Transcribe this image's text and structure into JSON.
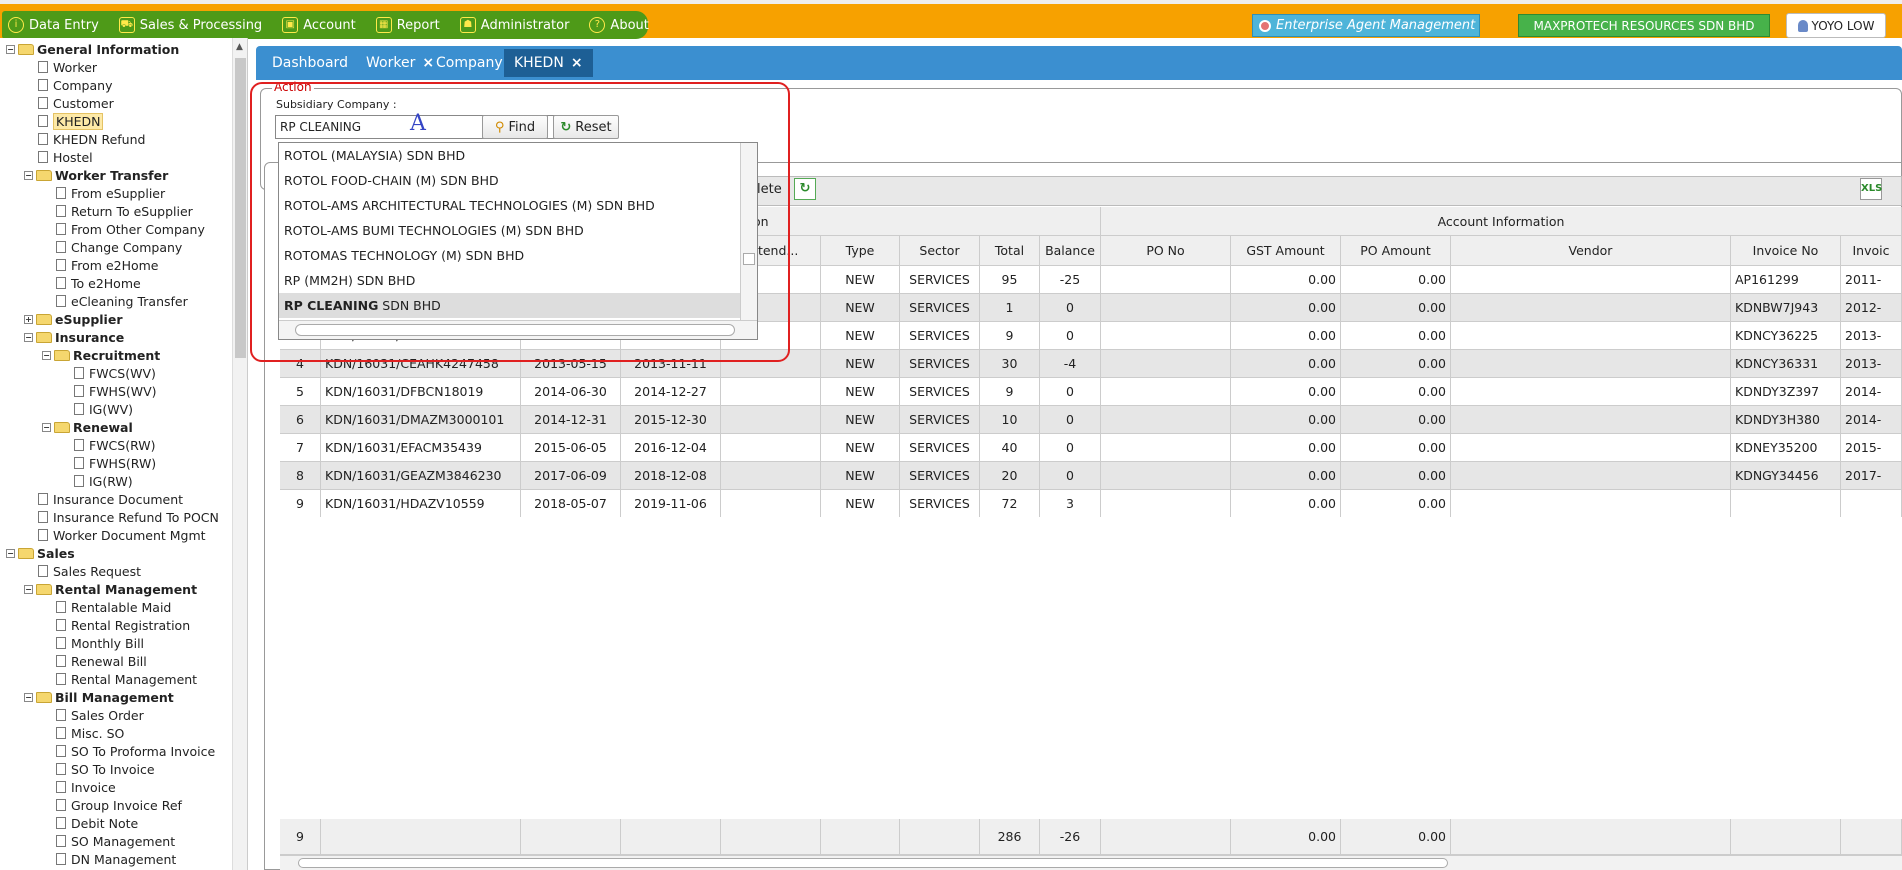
{
  "menu": {
    "items": [
      {
        "label": "Data Entry",
        "icon": "info-icon"
      },
      {
        "label": "Sales & Processing",
        "icon": "cart-icon"
      },
      {
        "label": "Account",
        "icon": "briefcase-icon"
      },
      {
        "label": "Report",
        "icon": "table-icon"
      },
      {
        "label": "Administrator",
        "icon": "users-icon"
      },
      {
        "label": "About",
        "icon": "help-icon"
      }
    ],
    "agent_label": "Enterprise Agent Management",
    "company_label": "MAXPROTECH RESOURCES SDN BHD",
    "user_label": "YOYO LOW"
  },
  "sidebar": {
    "items": [
      {
        "label": "General Information",
        "kind": "group",
        "level": 0,
        "toggle": "−"
      },
      {
        "label": "Worker",
        "kind": "file",
        "level": 1
      },
      {
        "label": "Company",
        "kind": "file",
        "level": 1
      },
      {
        "label": "Customer",
        "kind": "file",
        "level": 1
      },
      {
        "label": "KHEDN",
        "kind": "file",
        "level": 1,
        "selected": true
      },
      {
        "label": "KHEDN Refund",
        "kind": "file",
        "level": 1
      },
      {
        "label": "Hostel",
        "kind": "file",
        "level": 1
      },
      {
        "label": "Worker Transfer",
        "kind": "group",
        "level": 1,
        "toggle": "−"
      },
      {
        "label": "From eSupplier",
        "kind": "file",
        "level": 2
      },
      {
        "label": "Return To eSupplier",
        "kind": "file",
        "level": 2
      },
      {
        "label": "From Other Company",
        "kind": "file",
        "level": 2
      },
      {
        "label": "Change Company",
        "kind": "file",
        "level": 2
      },
      {
        "label": "From e2Home",
        "kind": "file",
        "level": 2
      },
      {
        "label": "To e2Home",
        "kind": "file",
        "level": 2
      },
      {
        "label": "eCleaning Transfer",
        "kind": "file",
        "level": 2
      },
      {
        "label": "eSupplier",
        "kind": "group",
        "level": 1,
        "toggle": "+"
      },
      {
        "label": "Insurance",
        "kind": "group",
        "level": 1,
        "toggle": "−"
      },
      {
        "label": "Recruitment",
        "kind": "group",
        "level": 2,
        "toggle": "−"
      },
      {
        "label": "FWCS(WV)",
        "kind": "file",
        "level": 3
      },
      {
        "label": "FWHS(WV)",
        "kind": "file",
        "level": 3
      },
      {
        "label": "IG(WV)",
        "kind": "file",
        "level": 3
      },
      {
        "label": "Renewal",
        "kind": "group",
        "level": 2,
        "toggle": "−"
      },
      {
        "label": "FWCS(RW)",
        "kind": "file",
        "level": 3
      },
      {
        "label": "FWHS(RW)",
        "kind": "file",
        "level": 3
      },
      {
        "label": "IG(RW)",
        "kind": "file",
        "level": 3
      },
      {
        "label": "Insurance Document",
        "kind": "file",
        "level": 1
      },
      {
        "label": "Insurance Refund To POCN",
        "kind": "file",
        "level": 1
      },
      {
        "label": "Worker Document Mgmt",
        "kind": "file",
        "level": 1
      },
      {
        "label": "Sales",
        "kind": "group",
        "level": 0,
        "toggle": "−"
      },
      {
        "label": "Sales Request",
        "kind": "file",
        "level": 1
      },
      {
        "label": "Rental Management",
        "kind": "group",
        "level": 1,
        "toggle": "−"
      },
      {
        "label": "Rentalable Maid",
        "kind": "file",
        "level": 2
      },
      {
        "label": "Rental Registration",
        "kind": "file",
        "level": 2
      },
      {
        "label": "Monthly Bill",
        "kind": "file",
        "level": 2
      },
      {
        "label": "Renewal Bill",
        "kind": "file",
        "level": 2
      },
      {
        "label": "Rental Management",
        "kind": "file",
        "level": 2
      },
      {
        "label": "Bill Management",
        "kind": "group",
        "level": 1,
        "toggle": "−"
      },
      {
        "label": "Sales Order",
        "kind": "file",
        "level": 2
      },
      {
        "label": "Misc. SO",
        "kind": "file",
        "level": 2
      },
      {
        "label": "SO To Proforma Invoice",
        "kind": "file",
        "level": 2
      },
      {
        "label": "SO To Invoice",
        "kind": "file",
        "level": 2
      },
      {
        "label": "Invoice",
        "kind": "file",
        "level": 2
      },
      {
        "label": "Group Invoice Ref",
        "kind": "file",
        "level": 2
      },
      {
        "label": "Debit Note",
        "kind": "file",
        "level": 2
      },
      {
        "label": "SO Management",
        "kind": "file",
        "level": 2
      },
      {
        "label": "DN Management",
        "kind": "file",
        "level": 2
      }
    ]
  },
  "tabs": [
    {
      "label": "Dashboard",
      "closable": false
    },
    {
      "label": "Worker",
      "closable": true
    },
    {
      "label": "Company",
      "closable": true
    },
    {
      "label": "KHEDN",
      "closable": true,
      "active": true
    }
  ],
  "action": {
    "legend": "Action",
    "subsidiary_label": "Subsidiary Company :",
    "subsidiary_value": "RP CLEANING",
    "marker": "A",
    "find_label": "Find",
    "reset_label": "Reset"
  },
  "dropdown": {
    "options": [
      "ROTOL (MALAYSIA) SDN BHD",
      "ROTOL FOOD-CHAIN (M) SDN BHD",
      "ROTOL-AMS ARCHITECTURAL TECHNOLOGIES (M) SDN BHD",
      "ROTOL-AMS BUMI TECHNOLOGIES (M) SDN BHD",
      "ROTOMAS TECHNOLOGY (M) SDN BHD",
      "RP (MM2H) SDN BHD"
    ],
    "selected_bold": "RP CLEANING",
    "selected_rest": " SDN BHD"
  },
  "grid": {
    "toolbar_delete_label": "elete",
    "group_headers": {
      "left": "on",
      "account": "Account Information"
    },
    "columns": [
      "Extend...",
      "Type",
      "Sector",
      "Total",
      "Balance",
      "PO No",
      "GST Amount",
      "PO Amount",
      "Vendor",
      "Invoice No",
      "Invoic"
    ],
    "rows": [
      {
        "no": "1",
        "ref": "",
        "date1": "",
        "date2": "",
        "extend": "",
        "type": "NEW",
        "sector": "SERVICES",
        "total": "95",
        "balance": "-25",
        "po_no": "",
        "gst": "0.00",
        "po_amount": "0.00",
        "vendor": "",
        "invoice_no": "AP161299",
        "invoice_date": "2011-"
      },
      {
        "no": "2",
        "ref": "",
        "date1": "",
        "date2": "",
        "extend": "",
        "type": "NEW",
        "sector": "SERVICES",
        "total": "1",
        "balance": "0",
        "po_no": "",
        "gst": "0.00",
        "po_amount": "0.00",
        "vendor": "",
        "invoice_no": "KDNBW7J943",
        "invoice_date": "2012-"
      },
      {
        "no": "3",
        "ref": "KDN/16031/CEAAZ2020097",
        "date1": "2013-05-14",
        "date2": "2013-11-10",
        "extend": "",
        "type": "NEW",
        "sector": "SERVICES",
        "total": "9",
        "balance": "0",
        "po_no": "",
        "gst": "0.00",
        "po_amount": "0.00",
        "vendor": "",
        "invoice_no": "KDNCY36225",
        "invoice_date": "2013-"
      },
      {
        "no": "4",
        "ref": "KDN/16031/CEAHK4247458",
        "date1": "2013-05-15",
        "date2": "2013-11-11",
        "extend": "",
        "type": "NEW",
        "sector": "SERVICES",
        "total": "30",
        "balance": "-4",
        "po_no": "",
        "gst": "0.00",
        "po_amount": "0.00",
        "vendor": "",
        "invoice_no": "KDNCY36331",
        "invoice_date": "2013-"
      },
      {
        "no": "5",
        "ref": "KDN/16031/DFBCN18019",
        "date1": "2014-06-30",
        "date2": "2014-12-27",
        "extend": "",
        "type": "NEW",
        "sector": "SERVICES",
        "total": "9",
        "balance": "0",
        "po_no": "",
        "gst": "0.00",
        "po_amount": "0.00",
        "vendor": "",
        "invoice_no": "KDNDY3Z397",
        "invoice_date": "2014-"
      },
      {
        "no": "6",
        "ref": "KDN/16031/DMAZM3000101",
        "date1": "2014-12-31",
        "date2": "2015-12-30",
        "extend": "",
        "type": "NEW",
        "sector": "SERVICES",
        "total": "10",
        "balance": "0",
        "po_no": "",
        "gst": "0.00",
        "po_amount": "0.00",
        "vendor": "",
        "invoice_no": "KDNDY3H380",
        "invoice_date": "2014-"
      },
      {
        "no": "7",
        "ref": "KDN/16031/EFACM35439",
        "date1": "2015-06-05",
        "date2": "2016-12-04",
        "extend": "",
        "type": "NEW",
        "sector": "SERVICES",
        "total": "40",
        "balance": "0",
        "po_no": "",
        "gst": "0.00",
        "po_amount": "0.00",
        "vendor": "",
        "invoice_no": "KDNEY35200",
        "invoice_date": "2015-"
      },
      {
        "no": "8",
        "ref": "KDN/16031/GEAZM3846230",
        "date1": "2017-06-09",
        "date2": "2018-12-08",
        "extend": "",
        "type": "NEW",
        "sector": "SERVICES",
        "total": "20",
        "balance": "0",
        "po_no": "",
        "gst": "0.00",
        "po_amount": "0.00",
        "vendor": "",
        "invoice_no": "KDNGY34456",
        "invoice_date": "2017-"
      },
      {
        "no": "9",
        "ref": "KDN/16031/HDAZV10559",
        "date1": "2018-05-07",
        "date2": "2019-11-06",
        "extend": "",
        "type": "NEW",
        "sector": "SERVICES",
        "total": "72",
        "balance": "3",
        "po_no": "",
        "gst": "0.00",
        "po_amount": "0.00",
        "vendor": "",
        "invoice_no": "",
        "invoice_date": ""
      }
    ],
    "footer": {
      "count": "9",
      "total": "286",
      "balance": "-26",
      "gst": "0.00",
      "po_amount": "0.00"
    }
  }
}
